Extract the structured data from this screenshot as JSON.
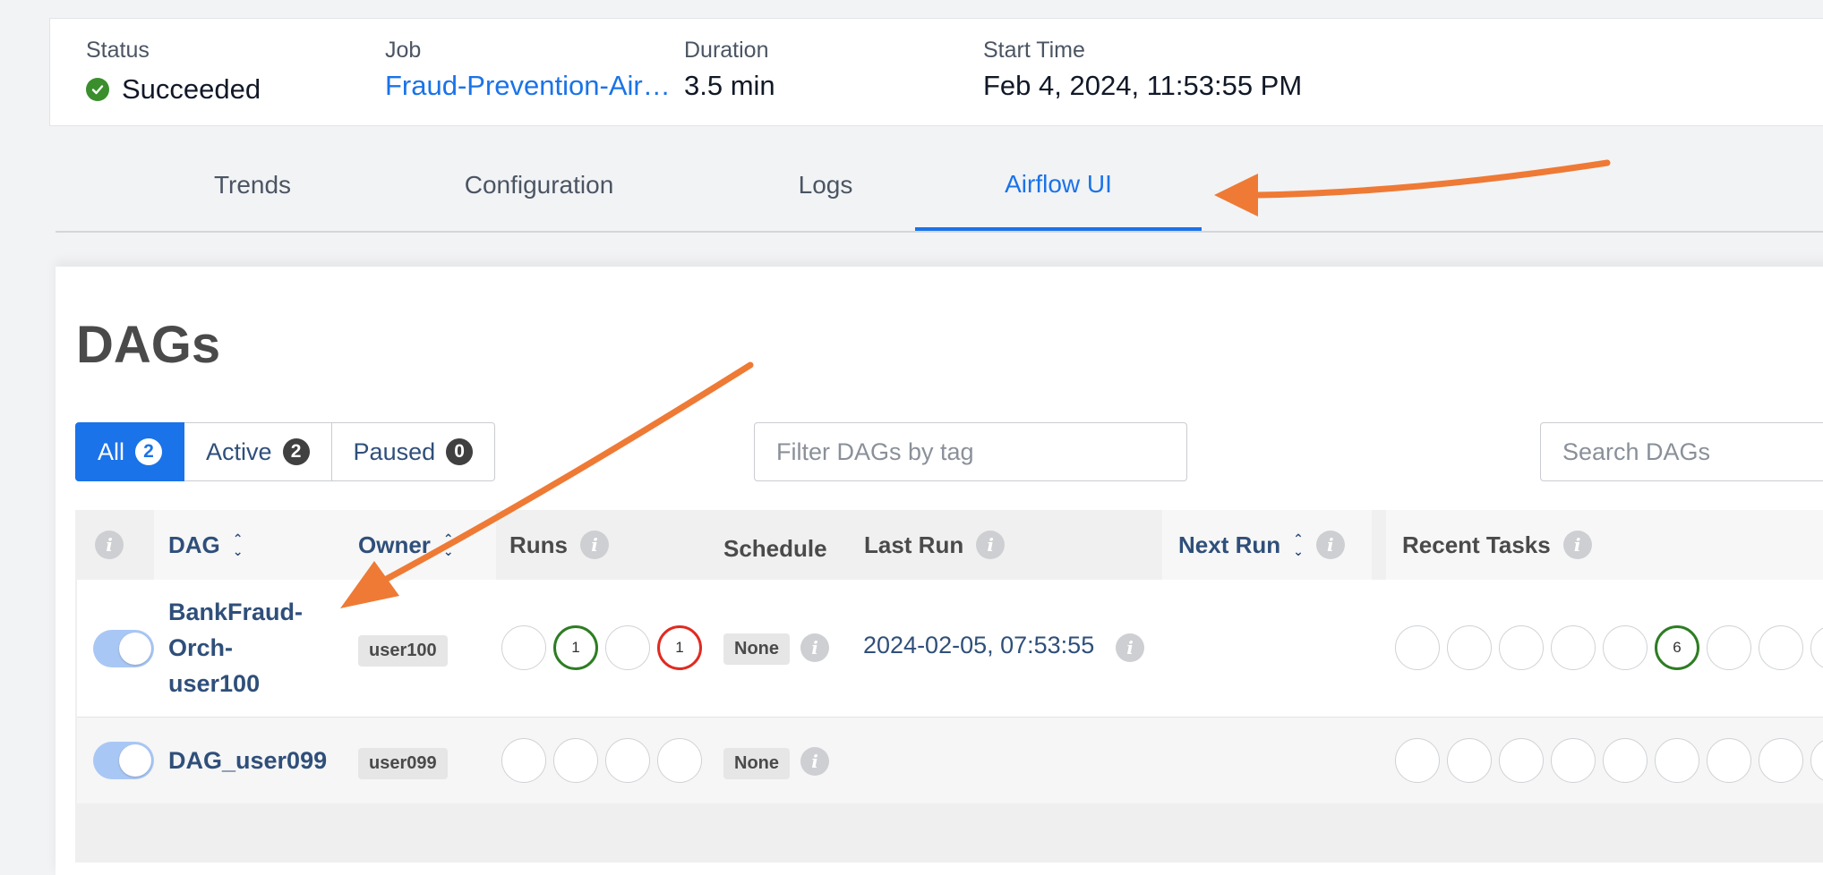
{
  "summary": {
    "status_label": "Status",
    "status_value": "Succeeded",
    "job_label": "Job",
    "job_value": "Fraud-Prevention-Air…",
    "duration_label": "Duration",
    "duration_value": "3.5 min",
    "start_label": "Start Time",
    "start_value": "Feb 4, 2024, 11:53:55 PM",
    "status_color": "#3a8f2c"
  },
  "tabs": [
    "Trends",
    "Configuration",
    "Logs",
    "Airflow UI"
  ],
  "active_tab": "Airflow UI",
  "page_title": "DAGs",
  "filters": {
    "all_label": "All",
    "all_count": "2",
    "active_label": "Active",
    "active_count": "2",
    "paused_label": "Paused",
    "paused_count": "0",
    "tag_placeholder": "Filter DAGs by tag",
    "search_placeholder": "Search DAGs"
  },
  "table": {
    "headers": {
      "dag": "DAG",
      "owner": "Owner",
      "runs": "Runs",
      "schedule": "Schedule",
      "last_run": "Last Run",
      "next_run": "Next Run",
      "recent_tasks": "Recent Tasks"
    },
    "rows": [
      {
        "name_lines": [
          "BankFraud-",
          "Orch-",
          "user100"
        ],
        "owner": "user100",
        "runs": [
          "",
          "1",
          "",
          "1"
        ],
        "run_states": [
          "none",
          "success",
          "none",
          "failed"
        ],
        "schedule": "None",
        "last_run": "2024-02-05, 07:53:55",
        "recent_tasks": [
          "",
          "",
          "",
          "",
          "",
          "6",
          "",
          "",
          ""
        ],
        "recent_task_states": [
          "none",
          "none",
          "none",
          "none",
          "none",
          "success",
          "none",
          "none",
          "none"
        ]
      },
      {
        "name": "DAG_user099",
        "owner": "user099",
        "runs": [
          "",
          "",
          "",
          ""
        ],
        "schedule": "None",
        "recent_tasks": [
          "",
          "",
          "",
          "",
          "",
          "",
          "",
          "",
          ""
        ]
      }
    ]
  },
  "colors": {
    "accent": "#1a73e8",
    "annotation_arrow": "#ee7a35",
    "success": "#2e7d23",
    "failed": "#e02b20"
  }
}
